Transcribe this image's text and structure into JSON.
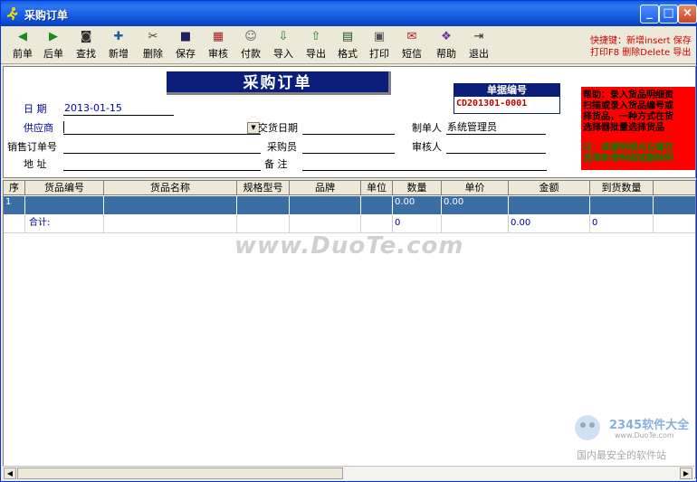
{
  "window": {
    "title": "采购订单",
    "buttons": {
      "minimize": "_",
      "maximize": "□",
      "close": "×"
    }
  },
  "toolbar": [
    {
      "label": "前单",
      "icon": "prev-icon",
      "glyph": "◀",
      "color": "#1a8a1a"
    },
    {
      "label": "后单",
      "icon": "next-icon",
      "glyph": "▶",
      "color": "#1a8a1a"
    },
    {
      "label": "查找",
      "icon": "binoculars-icon",
      "glyph": "◙",
      "color": "#303030"
    },
    {
      "label": "新增",
      "icon": "new-icon",
      "glyph": "✚",
      "color": "#2060a0"
    },
    {
      "label": "删除",
      "icon": "delete-icon",
      "glyph": "✂",
      "color": "#404040"
    },
    {
      "label": "保存",
      "icon": "save-icon",
      "glyph": "■",
      "color": "#202060"
    },
    {
      "label": "审核",
      "icon": "audit-icon",
      "glyph": "▦",
      "color": "#a02020"
    },
    {
      "label": "付款",
      "icon": "pay-icon",
      "glyph": "☺",
      "color": "#606060"
    },
    {
      "label": "导入",
      "icon": "import-icon",
      "glyph": "⇩",
      "color": "#207020"
    },
    {
      "label": "导出",
      "icon": "export-icon",
      "glyph": "⇧",
      "color": "#207020"
    },
    {
      "label": "格式",
      "icon": "format-icon",
      "glyph": "▤",
      "color": "#205020"
    },
    {
      "label": "打印",
      "icon": "printer-icon",
      "glyph": "▣",
      "color": "#505050"
    },
    {
      "label": "短信",
      "icon": "sms-icon",
      "glyph": "✉",
      "color": "#b02020"
    },
    {
      "label": "帮助",
      "icon": "help-book-icon",
      "glyph": "❖",
      "color": "#7030a0"
    },
    {
      "label": "退出",
      "icon": "exit-icon",
      "glyph": "⇥",
      "color": "#303030"
    }
  ],
  "hotkeys": {
    "line1": "快捷键：新增insert 保存",
    "line2": "打印F8 删除Delete 导出"
  },
  "form": {
    "title": "采购订单",
    "doc_no_label": "单据编号",
    "doc_no": "CD201301-0001",
    "date_label": "日  期",
    "date": "2013-01-15",
    "supplier_label": "供应商",
    "supplier": "",
    "delivery_date_label": "交货日期",
    "delivery_date": "",
    "maker_label": "制单人",
    "maker": "系统管理员",
    "sales_order_label": "销售订单号",
    "sales_order": "",
    "buyer_label": "采购员",
    "buyer": "",
    "reviewer_label": "审核人",
    "reviewer": "",
    "address_label": "地  址",
    "address": "",
    "remark_label": "备  注",
    "remark": ""
  },
  "help": {
    "text": "帮助：录入货品明细资\n扫描或录入货品编号或\n择货品，一种方式在货\n选择器批量选择货品",
    "note": "注：单据明细点右键在\n选择新增明细或删除明"
  },
  "grid": {
    "columns": [
      "序",
      "货品编号",
      "货品名称",
      "规格型号",
      "品牌",
      "单位",
      "数量",
      "单价",
      "金额",
      "到货数量"
    ],
    "rows": [
      {
        "seq": "1",
        "code": "",
        "name": "",
        "spec": "",
        "brand": "",
        "unit": "",
        "qty": "0.00",
        "price": "0.00",
        "amount": "",
        "arrived": ""
      }
    ],
    "total": {
      "label": "合计:",
      "qty": "0",
      "amount": "0.00",
      "arrived": "0"
    }
  },
  "watermark": {
    "site": "www.DuoTe.com",
    "logo_text": "2345软件大全",
    "logo_url": "www.DuoTe.com",
    "slogan": "国内最安全的软件站"
  }
}
